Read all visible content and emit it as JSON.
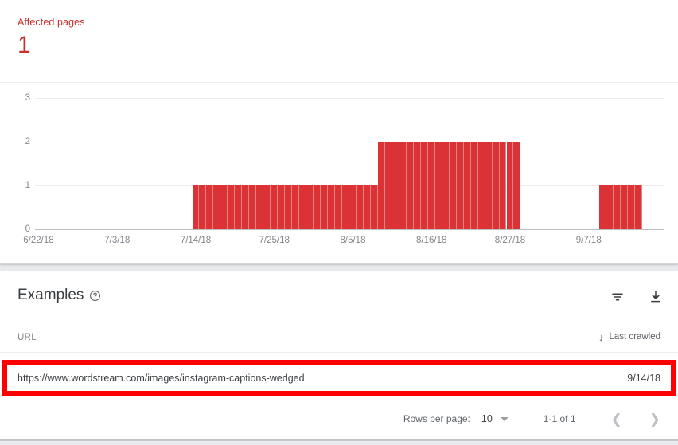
{
  "summary": {
    "label": "Affected pages",
    "value": "1",
    "accent_color": "#c5322f"
  },
  "chart_data": {
    "type": "bar",
    "title": "",
    "xlabel": "",
    "ylabel": "",
    "ylim": [
      0,
      3
    ],
    "yticks": [
      "0",
      "1",
      "2",
      "3"
    ],
    "grid": true,
    "legend": false,
    "bar_color": "#db3236",
    "xtick_labels": [
      "6/22/18",
      "7/3/18",
      "7/14/18",
      "7/25/18",
      "8/5/18",
      "8/16/18",
      "8/27/18",
      "9/7/18"
    ],
    "x": [
      "6/22/18",
      "6/23/18",
      "6/24/18",
      "6/25/18",
      "6/26/18",
      "6/27/18",
      "6/28/18",
      "6/29/18",
      "6/30/18",
      "7/1/18",
      "7/2/18",
      "7/3/18",
      "7/4/18",
      "7/5/18",
      "7/6/18",
      "7/7/18",
      "7/8/18",
      "7/9/18",
      "7/10/18",
      "7/11/18",
      "7/12/18",
      "7/13/18",
      "7/14/18",
      "7/15/18",
      "7/16/18",
      "7/17/18",
      "7/18/18",
      "7/19/18",
      "7/20/18",
      "7/21/18",
      "7/22/18",
      "7/23/18",
      "7/24/18",
      "7/25/18",
      "7/26/18",
      "7/27/18",
      "7/28/18",
      "7/29/18",
      "7/30/18",
      "7/31/18",
      "8/1/18",
      "8/2/18",
      "8/3/18",
      "8/4/18",
      "8/5/18",
      "8/6/18",
      "8/7/18",
      "8/8/18",
      "8/9/18",
      "8/10/18",
      "8/11/18",
      "8/12/18",
      "8/13/18",
      "8/14/18",
      "8/15/18",
      "8/16/18",
      "8/17/18",
      "8/18/18",
      "8/19/18",
      "8/20/18",
      "8/21/18",
      "8/22/18",
      "8/23/18",
      "8/24/18",
      "8/25/18",
      "8/26/18",
      "8/27/18",
      "8/28/18",
      "8/29/18",
      "8/30/18",
      "8/31/18",
      "9/1/18",
      "9/2/18",
      "9/3/18",
      "9/4/18",
      "9/5/18",
      "9/6/18",
      "9/7/18",
      "9/8/18",
      "9/9/18",
      "9/10/18",
      "9/11/18",
      "9/12/18",
      "9/13/18",
      "9/14/18",
      "9/15/18",
      "9/16/18",
      "9/17/18"
    ],
    "values": [
      0,
      0,
      0,
      0,
      0,
      0,
      0,
      0,
      0,
      0,
      0,
      0,
      0,
      0,
      0,
      0,
      0,
      0,
      0,
      0,
      0,
      0,
      1,
      1,
      1,
      1,
      1,
      1,
      1,
      1,
      1,
      1,
      1,
      1,
      1,
      1,
      1,
      1,
      1,
      1,
      1,
      1,
      1,
      1,
      1,
      1,
      1,
      1,
      2,
      2,
      2,
      2,
      2,
      2,
      2,
      2,
      2,
      2,
      2,
      2,
      2,
      2,
      2,
      2,
      2,
      2,
      2,
      2,
      0,
      0,
      0,
      0,
      0,
      0,
      0,
      0,
      0,
      0,
      0,
      1,
      1,
      1,
      1,
      1,
      1,
      0,
      0,
      0
    ]
  },
  "examples": {
    "title": "Examples",
    "help_icon": "help-circle-icon",
    "filter_icon": "filter-icon",
    "download_icon": "download-icon",
    "columns": {
      "url": "URL",
      "last_crawled": "Last crawled",
      "sort_arrow": "↓"
    },
    "rows": [
      {
        "url": "https://www.wordstream.com/images/instagram-captions-wedged",
        "last_crawled": "9/14/18",
        "highlighted": true
      }
    ]
  },
  "pagination": {
    "rows_per_page_label": "Rows per page:",
    "rows_per_page_value": "10",
    "range": "1-1 of 1",
    "prev_icon": "chevron-left-icon",
    "next_icon": "chevron-right-icon"
  },
  "annotation": {
    "color": "#ff0000",
    "target": "url-row"
  }
}
